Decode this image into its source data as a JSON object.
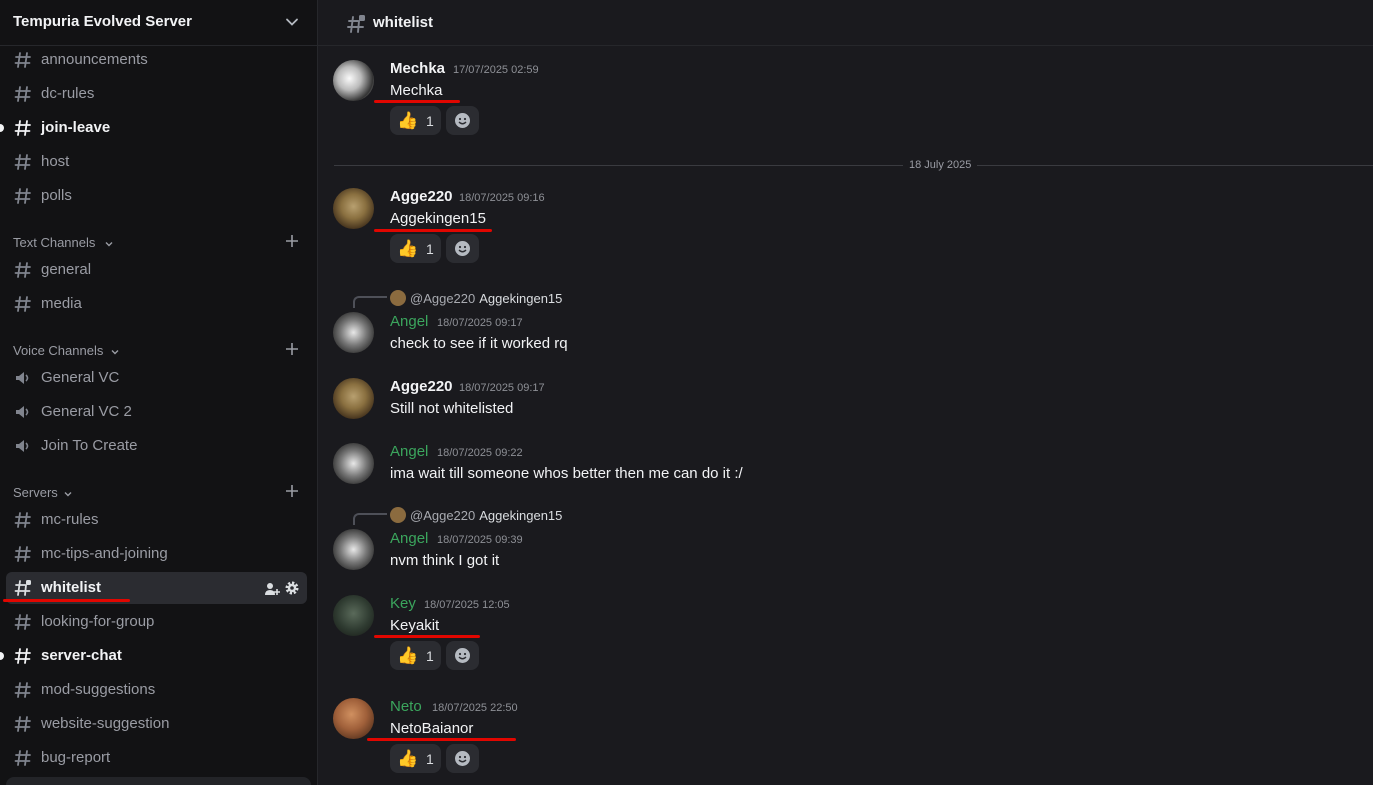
{
  "server": {
    "name": "Tempuria Evolved Server"
  },
  "channels_top": [
    {
      "name": "announcements",
      "unread": false
    },
    {
      "name": "dc-rules",
      "unread": false
    },
    {
      "name": "join-leave",
      "unread": true
    },
    {
      "name": "host",
      "unread": false
    },
    {
      "name": "polls",
      "unread": false
    }
  ],
  "categories": {
    "text": "Text Channels",
    "voice": "Voice Channels",
    "servers": "Servers"
  },
  "text_channels": [
    "general",
    "media"
  ],
  "voice_channels": [
    "General VC",
    "General VC 2",
    "Join To Create"
  ],
  "server_channels": [
    {
      "name": "mc-rules",
      "unread": false
    },
    {
      "name": "mc-tips-and-joining",
      "unread": false
    },
    {
      "name": "whitelist",
      "selected": true
    },
    {
      "name": "looking-for-group",
      "unread": false
    },
    {
      "name": "server-chat",
      "unread": true
    },
    {
      "name": "mod-suggestions",
      "unread": false
    },
    {
      "name": "website-suggestion",
      "unread": false
    },
    {
      "name": "bug-report",
      "unread": false
    }
  ],
  "topbar": {
    "channel": "whitelist"
  },
  "date_divider": "18 July 2025",
  "messages": [
    {
      "author": "Mechka",
      "time": "17/07/2025 02:59",
      "text": "Mechka",
      "reaction": {
        "emoji": "👍",
        "count": "1"
      }
    },
    {
      "author": "Agge220",
      "time": "18/07/2025 09:16",
      "text": "Aggekingen15",
      "reaction": {
        "emoji": "👍",
        "count": "1"
      }
    },
    {
      "author": "Angel",
      "time": "18/07/2025 09:17",
      "text": "check to see if it worked rq",
      "reply": {
        "mention": "@Agge220",
        "text": "Aggekingen15"
      }
    },
    {
      "author": "Agge220",
      "time": "18/07/2025 09:17",
      "text": "Still not whitelisted"
    },
    {
      "author": "Angel",
      "time": "18/07/2025 09:22",
      "text": "ima wait till someone whos better then me can do it :/"
    },
    {
      "author": "Angel",
      "time": "18/07/2025 09:39",
      "text": "nvm think I got it",
      "reply": {
        "mention": "@Agge220",
        "text": "Aggekingen15"
      }
    },
    {
      "author": "Key",
      "time": "18/07/2025 12:05",
      "text": "Keyakit",
      "reaction": {
        "emoji": "👍",
        "count": "1"
      }
    },
    {
      "author": "Neto",
      "time": "18/07/2025 22:50",
      "text": "NetoBaianor",
      "reaction": {
        "emoji": "👍",
        "count": "1"
      }
    }
  ],
  "colors": {
    "annotation_red": "#e10600",
    "role_green": "#3ba55d"
  }
}
